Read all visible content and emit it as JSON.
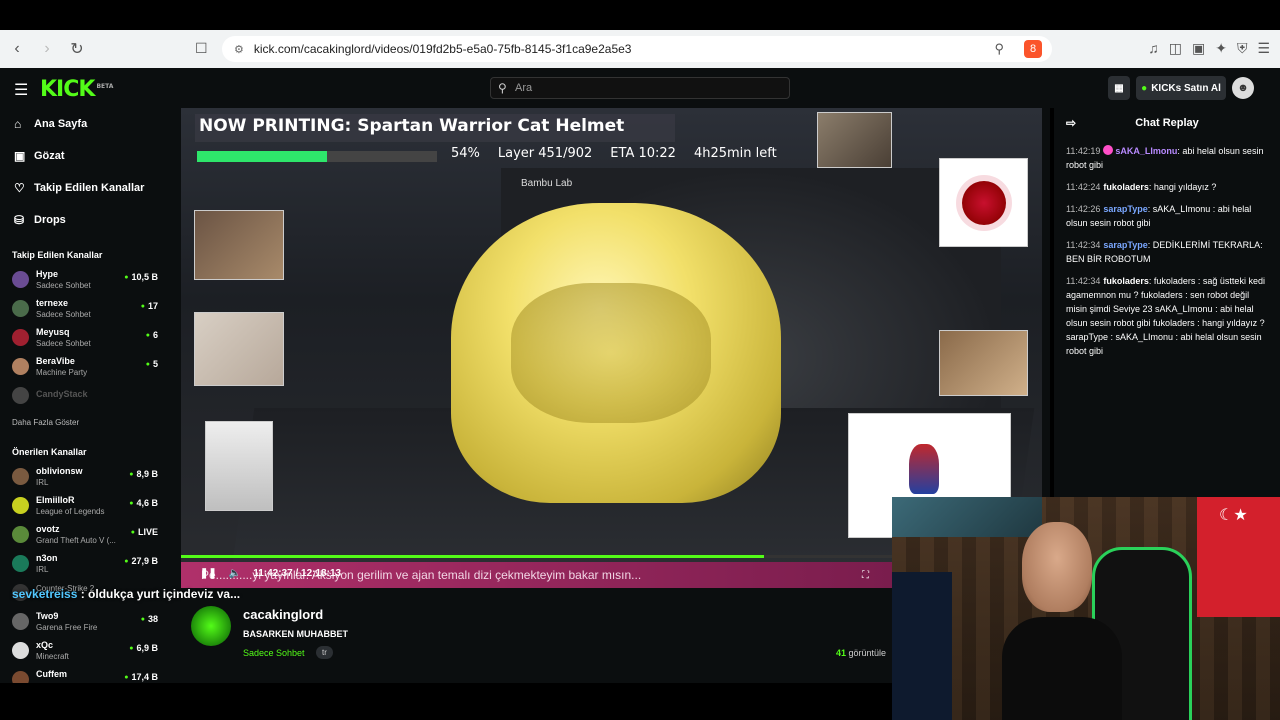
{
  "browser": {
    "url": "kick.com/cacakinglord/videos/019fd2b5-e5a0-75fb-8145-3f1ca9e2a5e3",
    "extension_badge": "8"
  },
  "header": {
    "logo": "KICK",
    "logo_badge": "BETA",
    "search_placeholder": "Ara",
    "kicks_button": "KICKs Satın Al"
  },
  "sidebar": {
    "nav": [
      {
        "label": "Ana Sayfa",
        "icon": "home-icon"
      },
      {
        "label": "Gözat",
        "icon": "browse-icon"
      },
      {
        "label": "Takip Edilen Kanallar",
        "icon": "heart-icon"
      },
      {
        "label": "Drops",
        "icon": "drops-icon"
      }
    ],
    "followed_title": "Takip Edilen Kanallar",
    "followed": [
      {
        "name": "Hype",
        "category": "Sadece Sohbet",
        "viewers": "10,5 B",
        "color": "#6a4c93"
      },
      {
        "name": "ternexe",
        "category": "Sadece Sohbet",
        "viewers": "17",
        "color": "#4a6b4a"
      },
      {
        "name": "Meyusq",
        "category": "Sadece Sohbet",
        "viewers": "6",
        "color": "#a02030"
      },
      {
        "name": "BeraVibe",
        "category": "Machine Party",
        "viewers": "5",
        "color": "#b08060"
      },
      {
        "name": "CandyStack",
        "category": "",
        "viewers": "",
        "color": "#444"
      }
    ],
    "show_more": "Daha Fazla Göster",
    "recommended_title": "Önerilen Kanallar",
    "recommended": [
      {
        "name": "oblivionsw",
        "category": "IRL",
        "viewers": "8,9 B",
        "color": "#7a5a40"
      },
      {
        "name": "ElmiilloR",
        "category": "League of Legends",
        "viewers": "4,6 B",
        "color": "#c8d020"
      },
      {
        "name": "ovotz",
        "category": "Grand Theft Auto V (...",
        "viewers": "LIVE",
        "color": "#5a8a3a"
      },
      {
        "name": "n3on",
        "category": "IRL",
        "viewers": "27,9 B",
        "color": "#1a7a5a"
      },
      {
        "name": "",
        "category": "Counter-Strike 2",
        "viewers": "",
        "color": "#333"
      },
      {
        "name": "Two9",
        "category": "Garena Free Fire",
        "viewers": "38",
        "color": "#666"
      },
      {
        "name": "xQc",
        "category": "Minecraft",
        "viewers": "6,9 B",
        "color": "#ddd"
      },
      {
        "name": "Cuffem",
        "category": "",
        "viewers": "17,4 B",
        "color": "#7a4a30"
      }
    ]
  },
  "video": {
    "overlay_title": "NOW PRINTING:  Spartan Warrior Cat Helmet",
    "print_progress": 0.54,
    "percent": "54%",
    "layer": "Layer 451/902",
    "eta": "ETA 10:22",
    "elapsed": "4h25min left",
    "printer_brand": "Bambu Lab",
    "ticker": "Pe...........yi yayınlar. Aksiyon gerilim ve ajan temalı dizi çekmekteyim bakar mısın...",
    "time": "11:42:37 / 12:18:13",
    "seek_progress": 0.82
  },
  "chat_overlay": {
    "user": "sevketreiss",
    "text": " : oldukça yurt içindeyiz ya..."
  },
  "stream_info": {
    "channel": "cacakinglord",
    "title": "BASARKEN MUHABBET",
    "category": "Sadece Sohbet",
    "language": "tr",
    "viewers": "41",
    "viewers_label": " görüntüle"
  },
  "chat": {
    "title": "Chat Replay",
    "messages": [
      {
        "time": "11:42:19",
        "user": "sAKA_LImonu",
        "user_style": "u1",
        "badge": true,
        "text": ": abi helal olsun sesin robot gibi"
      },
      {
        "time": "11:42:24",
        "user": "fukoladers",
        "user_style": "u2",
        "badge": false,
        "text": ": hangi yıldayız ?"
      },
      {
        "time": "11:42:26",
        "user": "sarapType",
        "user_style": "u3",
        "badge": false,
        "text": ": sAKA_LImonu : abi helal olsun sesin robot gibi"
      },
      {
        "time": "11:42:34",
        "user": "sarapType",
        "user_style": "u3",
        "badge": false,
        "text": ": DEDİKLERİMİ TEKRARLA: BEN BİR ROBOTUM"
      },
      {
        "time": "11:42:34",
        "user": "fukoladers",
        "user_style": "u2",
        "badge": false,
        "text": ": fukoladers : sağ üstteki kedi agamemnon mu ? fukoladers : sen robot değil misin şimdi Seviye 23 sAKA_LImonu : abi helal olsun sesin robot gibi fukoladers : hangi yıldayız ? sarapType : sAKA_LImonu : abi helal olsun sesin robot gibi"
      }
    ]
  }
}
